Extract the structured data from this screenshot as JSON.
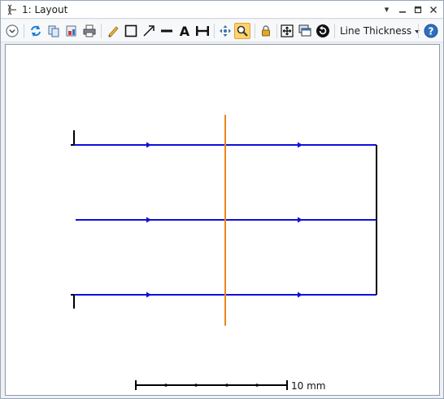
{
  "window": {
    "title": "1: Layout",
    "controls": [
      "dropdown-icon",
      "minimize-icon",
      "restore-icon",
      "close-icon"
    ]
  },
  "toolbar": {
    "buttons": [
      "settings-expand-icon",
      "refresh-icon",
      "copy-icon",
      "export-icon",
      "print-icon",
      "pencil-icon",
      "rectangle-icon",
      "arrow-icon",
      "line-icon",
      "text-icon",
      "dimension-icon",
      "pan-icon",
      "zoom-icon",
      "lock-icon",
      "fit-icon",
      "window-icon",
      "reset-icon",
      "help-icon"
    ],
    "active": "zoom-icon",
    "line_thickness_label": "Line Thickness"
  },
  "canvas": {
    "colors": {
      "rays": "#1010d8",
      "lens": "#e8861c",
      "mechanics": "#000000"
    },
    "scale_bar_label": "10 mm"
  }
}
